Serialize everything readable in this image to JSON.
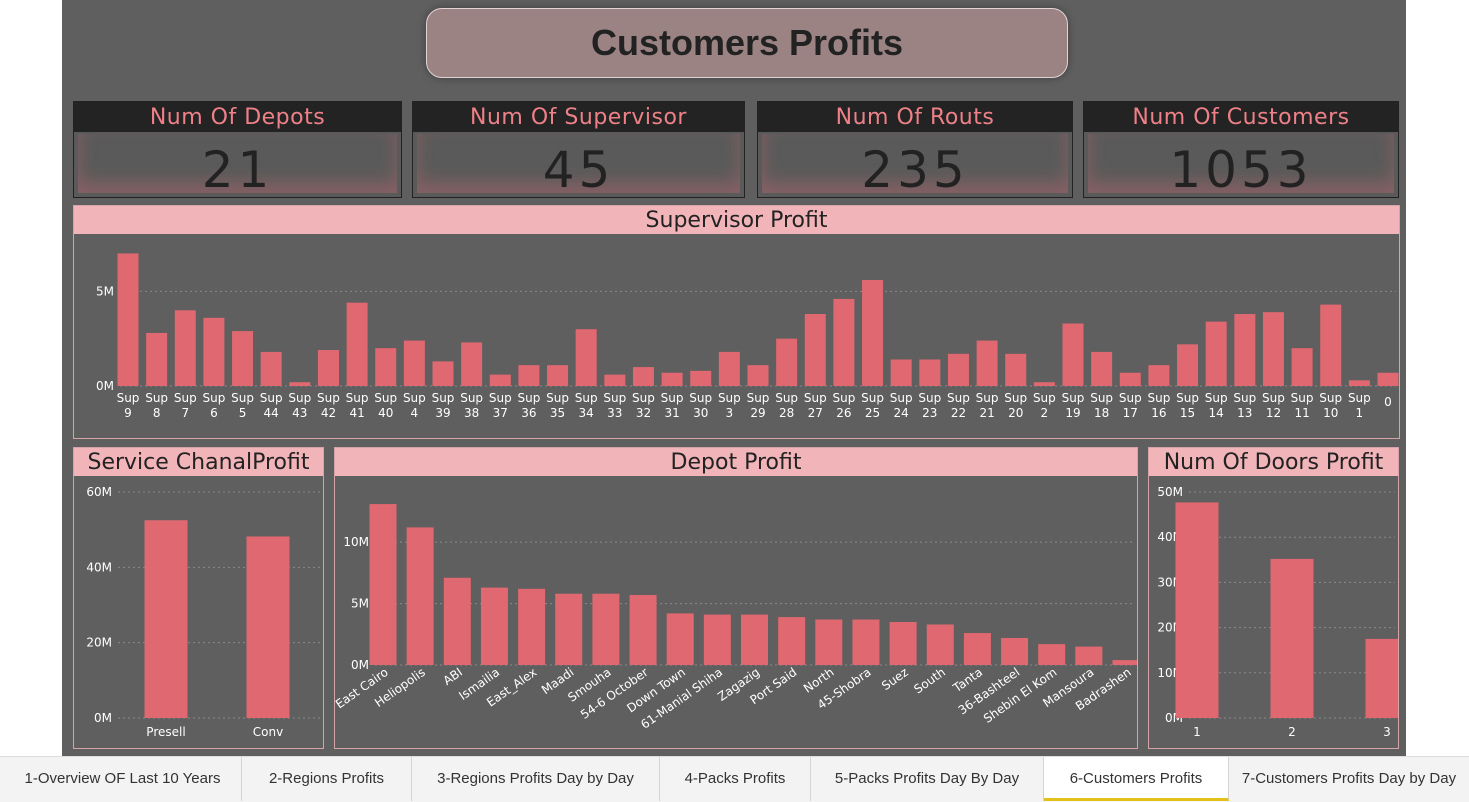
{
  "page_title": "Customers Profits",
  "kpis": [
    {
      "label": "Num Of Depots",
      "value": "21"
    },
    {
      "label": "Num Of Supervisor",
      "value": "45"
    },
    {
      "label": "Num Of Routs",
      "value": "235"
    },
    {
      "label": "Num Of Customers",
      "value": "1053"
    }
  ],
  "colors": {
    "bar": "#e06870",
    "header": "#f1b4b9",
    "canvas": "#5f5f5f",
    "kpi_label": "#ee8088"
  },
  "tabs": [
    {
      "label": "1-Overview OF Last 10 Years",
      "active": false
    },
    {
      "label": "2-Regions Profits",
      "active": false
    },
    {
      "label": "3-Regions Profits Day by Day",
      "active": false
    },
    {
      "label": "4-Packs Profits",
      "active": false
    },
    {
      "label": "5-Packs Profits Day By Day",
      "active": false
    },
    {
      "label": "6-Customers Profits",
      "active": true
    },
    {
      "label": "7-Customers Profits Day by Day",
      "active": false
    }
  ],
  "chart_data": [
    {
      "id": "supervisor",
      "type": "bar",
      "title": "Supervisor Profit",
      "categories": [
        [
          "Sup",
          "9"
        ],
        [
          "Sup",
          "8"
        ],
        [
          "Sup",
          "7"
        ],
        [
          "Sup",
          "6"
        ],
        [
          "Sup",
          "5"
        ],
        [
          "Sup",
          "44"
        ],
        [
          "Sup",
          "43"
        ],
        [
          "Sup",
          "42"
        ],
        [
          "Sup",
          "41"
        ],
        [
          "Sup",
          "40"
        ],
        [
          "Sup",
          "4"
        ],
        [
          "Sup",
          "39"
        ],
        [
          "Sup",
          "38"
        ],
        [
          "Sup",
          "37"
        ],
        [
          "Sup",
          "36"
        ],
        [
          "Sup",
          "35"
        ],
        [
          "Sup",
          "34"
        ],
        [
          "Sup",
          "33"
        ],
        [
          "Sup",
          "32"
        ],
        [
          "Sup",
          "31"
        ],
        [
          "Sup",
          "30"
        ],
        [
          "Sup",
          "3"
        ],
        [
          "Sup",
          "29"
        ],
        [
          "Sup",
          "28"
        ],
        [
          "Sup",
          "27"
        ],
        [
          "Sup",
          "26"
        ],
        [
          "Sup",
          "25"
        ],
        [
          "Sup",
          "24"
        ],
        [
          "Sup",
          "23"
        ],
        [
          "Sup",
          "22"
        ],
        [
          "Sup",
          "21"
        ],
        [
          "Sup",
          "20"
        ],
        [
          "Sup",
          "2"
        ],
        [
          "Sup",
          "19"
        ],
        [
          "Sup",
          "18"
        ],
        [
          "Sup",
          "17"
        ],
        [
          "Sup",
          "16"
        ],
        [
          "Sup",
          "15"
        ],
        [
          "Sup",
          "14"
        ],
        [
          "Sup",
          "13"
        ],
        [
          "Sup",
          "12"
        ],
        [
          "Sup",
          "11"
        ],
        [
          "Sup",
          "10"
        ],
        [
          "Sup",
          "1"
        ],
        [
          "0"
        ]
      ],
      "values": [
        7.0,
        2.8,
        4.0,
        3.6,
        2.9,
        1.8,
        0.2,
        1.9,
        4.4,
        2.0,
        2.4,
        1.3,
        2.3,
        0.6,
        1.1,
        1.1,
        3.0,
        0.6,
        1.0,
        0.7,
        0.8,
        1.8,
        1.1,
        2.5,
        3.8,
        4.6,
        5.6,
        1.4,
        1.4,
        1.7,
        2.4,
        1.7,
        0.2,
        3.3,
        1.8,
        0.7,
        1.1,
        2.2,
        3.4,
        3.8,
        3.9,
        2.0,
        4.3,
        0.3,
        0.7
      ],
      "unit": "M",
      "ylim": [
        0,
        7.5
      ],
      "yticks": [
        {
          "v": 0,
          "label": "0M"
        },
        {
          "v": 5,
          "label": "5M"
        }
      ],
      "grid": true
    },
    {
      "id": "service",
      "type": "bar",
      "title": "Service ChanalProfit",
      "categories": [
        "Presell",
        "Conv"
      ],
      "values": [
        52.5,
        48.2
      ],
      "unit": "M",
      "ylim": [
        0,
        60
      ],
      "yticks": [
        {
          "v": 0,
          "label": "0M"
        },
        {
          "v": 20,
          "label": "20M"
        },
        {
          "v": 40,
          "label": "40M"
        },
        {
          "v": 60,
          "label": "60M"
        }
      ],
      "grid": true
    },
    {
      "id": "depot",
      "type": "bar",
      "title": "Depot Profit",
      "categories": [
        "East Cairo",
        "Heliopolis",
        "ABI",
        "Ismailia",
        "East_Alex",
        "Maadi",
        "Smouha",
        "54-6 October",
        "Down Town",
        "61-Manial Shiha",
        "Zagazig",
        "Port Said",
        "North",
        "45-Shobra",
        "Suez",
        "South",
        "Tanta",
        "36-Bashteel",
        "Shebin El Kom",
        "Mansoura",
        "Badrashen"
      ],
      "values": [
        13.1,
        11.2,
        7.1,
        6.3,
        6.2,
        5.8,
        5.8,
        5.7,
        4.2,
        4.1,
        4.1,
        3.9,
        3.7,
        3.7,
        3.5,
        3.3,
        2.6,
        2.2,
        1.7,
        1.5,
        0.4
      ],
      "unit": "M",
      "ylim": [
        0,
        14
      ],
      "yticks": [
        {
          "v": 0,
          "label": "0M"
        },
        {
          "v": 5,
          "label": "5M"
        },
        {
          "v": 10,
          "label": "10M"
        }
      ],
      "grid": true
    },
    {
      "id": "doors",
      "type": "bar",
      "title": "Num Of Doors Profit",
      "categories": [
        "1",
        "2",
        "3"
      ],
      "values": [
        47.7,
        35.2,
        17.5
      ],
      "unit": "M",
      "ylim": [
        0,
        50
      ],
      "yticks": [
        {
          "v": 0,
          "label": "0M"
        },
        {
          "v": 10,
          "label": "10M"
        },
        {
          "v": 20,
          "label": "20M"
        },
        {
          "v": 30,
          "label": "30M"
        },
        {
          "v": 40,
          "label": "40M"
        },
        {
          "v": 50,
          "label": "50M"
        }
      ],
      "grid": true
    }
  ]
}
